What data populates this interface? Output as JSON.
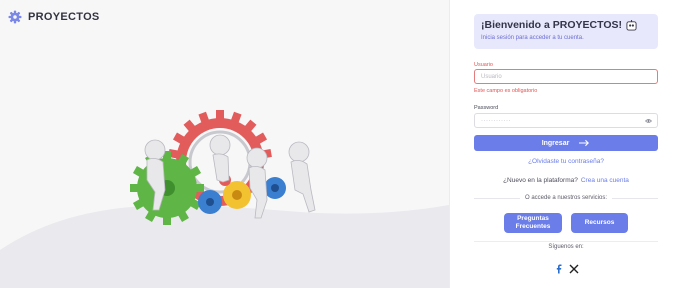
{
  "brand": {
    "name": "PROYECTOS",
    "logo_icon": "gear-icon"
  },
  "welcome": {
    "title": "¡Bienvenido a PROYECTOS!",
    "subtitle": "Inicia sesión para acceder a tu cuenta."
  },
  "form": {
    "username": {
      "label": "Usuario",
      "placeholder": "Usuario",
      "value": "",
      "error": "Este campo es obligatorio"
    },
    "password": {
      "label": "Password",
      "value": "············",
      "toggle_icon": "eye-icon"
    },
    "login_button": {
      "label": "Ingresar",
      "icon": "arrow-right-icon"
    },
    "forgot_link": "¿Olvidaste tu contraseña?",
    "new_prompt": "¿Nuevo en la plataforma?",
    "create_link": "Crea una cuenta"
  },
  "services": {
    "divider_text": "O accede a nuestros servicios:",
    "faq_label_line1": "Preguntas",
    "faq_label_line2": "Frecuentes",
    "resources_label": "Recursos"
  },
  "social": {
    "label": "Síguenos en:",
    "icons": [
      "facebook-icon",
      "x-icon"
    ]
  },
  "colors": {
    "accent": "#6b7de8",
    "error": "#e05556",
    "welcome_bg": "#e7e8fb"
  }
}
